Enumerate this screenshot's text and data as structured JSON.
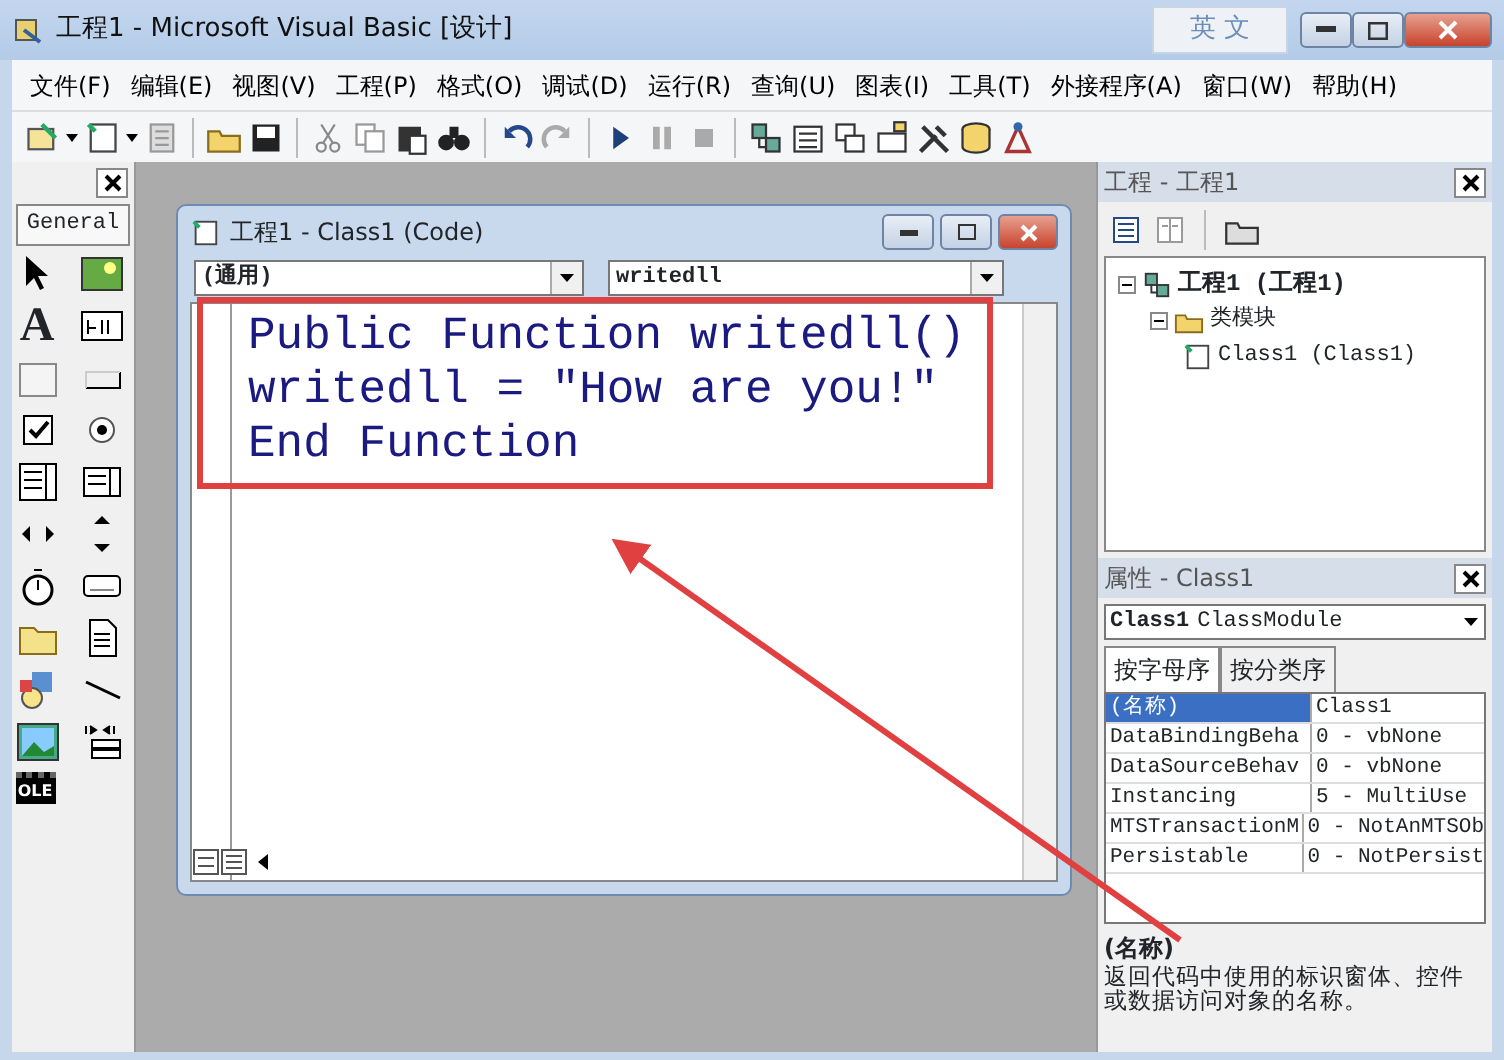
{
  "window": {
    "title": "工程1 - Microsoft Visual Basic [设计]",
    "ime_label": "英 文"
  },
  "menu": [
    "文件(F)",
    "编辑(E)",
    "视图(V)",
    "工程(P)",
    "格式(O)",
    "调试(D)",
    "运行(R)",
    "查询(U)",
    "图表(I)",
    "工具(T)",
    "外接程序(A)",
    "窗口(W)",
    "帮助(H)"
  ],
  "toolbox": {
    "title": "General",
    "label_tool_glyph": "A",
    "ole_tool_label": "OLE"
  },
  "code_window": {
    "title": "工程1 - Class1 (Code)",
    "object_combo": "(通用)",
    "procedure_combo": "writedll",
    "lines": [
      "Public Function writedll()",
      "writedll = \"How are you!\"",
      "End Function"
    ]
  },
  "project": {
    "title": "工程 - 工程1",
    "tree": [
      {
        "label": "工程1 (工程1)",
        "expanded": true,
        "children": [
          {
            "label": "类模块",
            "expanded": true,
            "children": [
              {
                "label": "Class1 (Class1)"
              }
            ]
          }
        ]
      }
    ]
  },
  "properties": {
    "title": "属性 - Class1",
    "object": "Class1",
    "object_type": "ClassModule",
    "tabs": [
      {
        "label": "按字母序",
        "selected": true
      },
      {
        "label": "按分类序",
        "selected": false
      }
    ],
    "rows": [
      {
        "name": "(名称)",
        "value": "Class1",
        "selected": true
      },
      {
        "name": "DataBindingBeha",
        "value": "0 - vbNone",
        "selected": false
      },
      {
        "name": "DataSourceBehav",
        "value": "0 - vbNone",
        "selected": false
      },
      {
        "name": "Instancing",
        "value": "5 - MultiUse",
        "selected": false
      },
      {
        "name": "MTSTransactionM",
        "value": "0 - NotAnMTSOb",
        "selected": false
      },
      {
        "name": "Persistable",
        "value": "0 - NotPersist",
        "selected": false
      }
    ],
    "description_title": "(名称)",
    "description": "返回代码中使用的标识窗体、控件或数据访问对象的名称。"
  }
}
